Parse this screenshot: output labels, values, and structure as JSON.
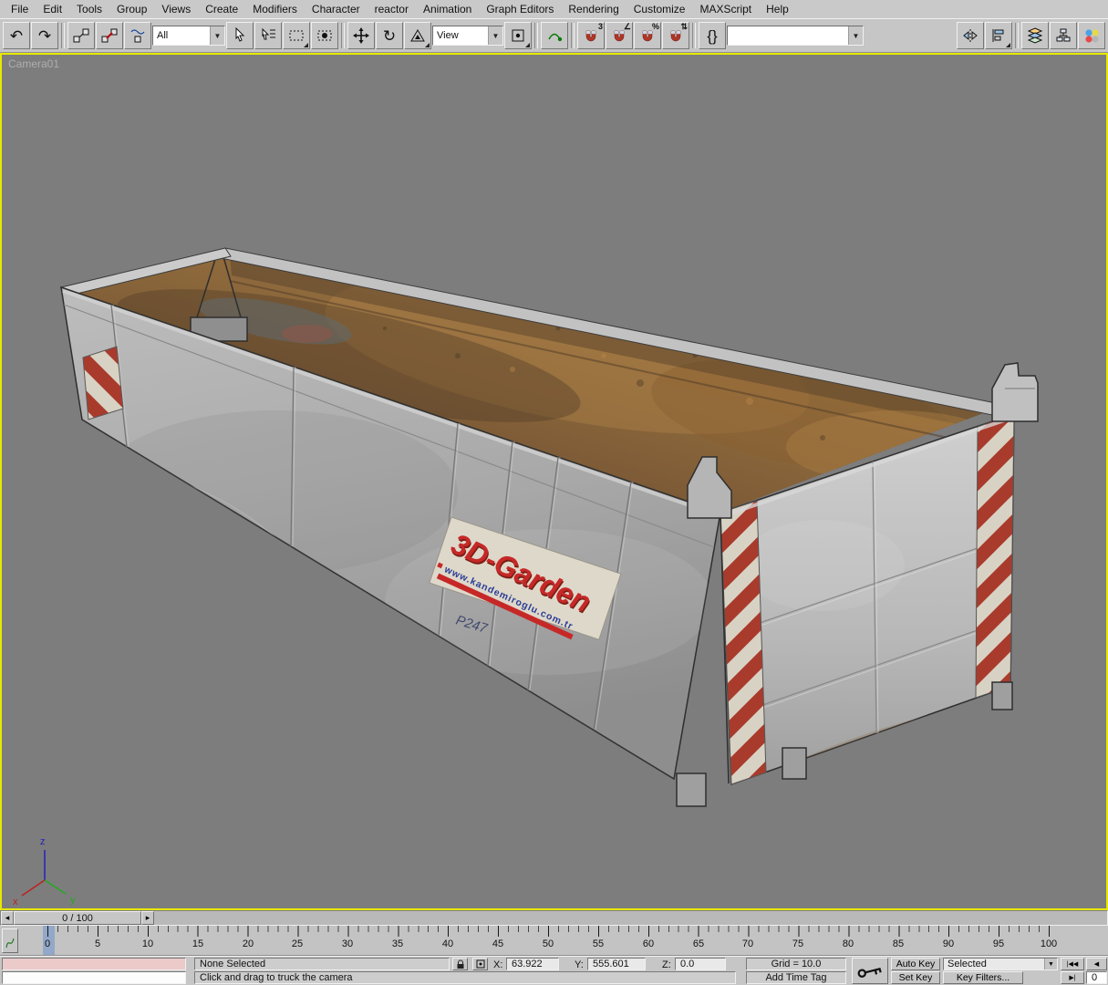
{
  "menu": {
    "items": [
      "File",
      "Edit",
      "Tools",
      "Group",
      "Views",
      "Create",
      "Modifiers",
      "Character",
      "reactor",
      "Animation",
      "Graph Editors",
      "Rendering",
      "Customize",
      "MAXScript",
      "Help"
    ]
  },
  "toolbar": {
    "selection_filter_value": "All",
    "coord_system_value": "View",
    "named_selection_value": "",
    "snap_badges": {
      "snaps": "3",
      "angle": "∠",
      "percent": "%",
      "spinner": "⇅"
    },
    "glyphs": {
      "undo": "↶",
      "redo": "↷",
      "rotate": "↻",
      "dropdown_arrow": "▼",
      "braces": "{}"
    }
  },
  "viewport": {
    "label": "Camera01",
    "axis": {
      "x": "x",
      "y": "y",
      "z": "z"
    }
  },
  "model": {
    "sign_line1": "3D-Garden",
    "sign_line2": "www.kandemiroglu.com.tr",
    "marking": "P247"
  },
  "timeline": {
    "slider_label": "0 / 100",
    "prev_glyph": "◂",
    "next_glyph": "▸",
    "ticks": [
      "0",
      "5",
      "10",
      "15",
      "20",
      "25",
      "30",
      "35",
      "40",
      "45",
      "50",
      "55",
      "60",
      "65",
      "70",
      "75",
      "80",
      "85",
      "90",
      "95",
      "100"
    ]
  },
  "status": {
    "selection_status": "None Selected",
    "prompt": "Click and drag to truck the camera",
    "coord_labels": {
      "x": "X:",
      "y": "Y:",
      "z": "Z:"
    },
    "coords": {
      "x": "63.922",
      "y": "555.601",
      "z": "0.0"
    },
    "grid": "Grid = 10.0",
    "add_time_tag": "Add Time Tag",
    "auto_key_label": "Auto Key",
    "set_key_label": "Set Key",
    "selected_filter_value": "Selected",
    "key_filters_label": "Key Filters...",
    "frame_value": "0",
    "playback": {
      "go_start": "|◀◀",
      "prev": "◀",
      "next": "▶|"
    }
  },
  "colors": {
    "active_viewport_border": "#e8e800",
    "viewport_background": "#7d7d7d",
    "hazard_red": "#a93b2c",
    "sign_red": "#c62828",
    "sign_url_blue": "#2b3d96",
    "ui_chrome": "#c6c6c6",
    "listener_pink": "#eccaca"
  }
}
